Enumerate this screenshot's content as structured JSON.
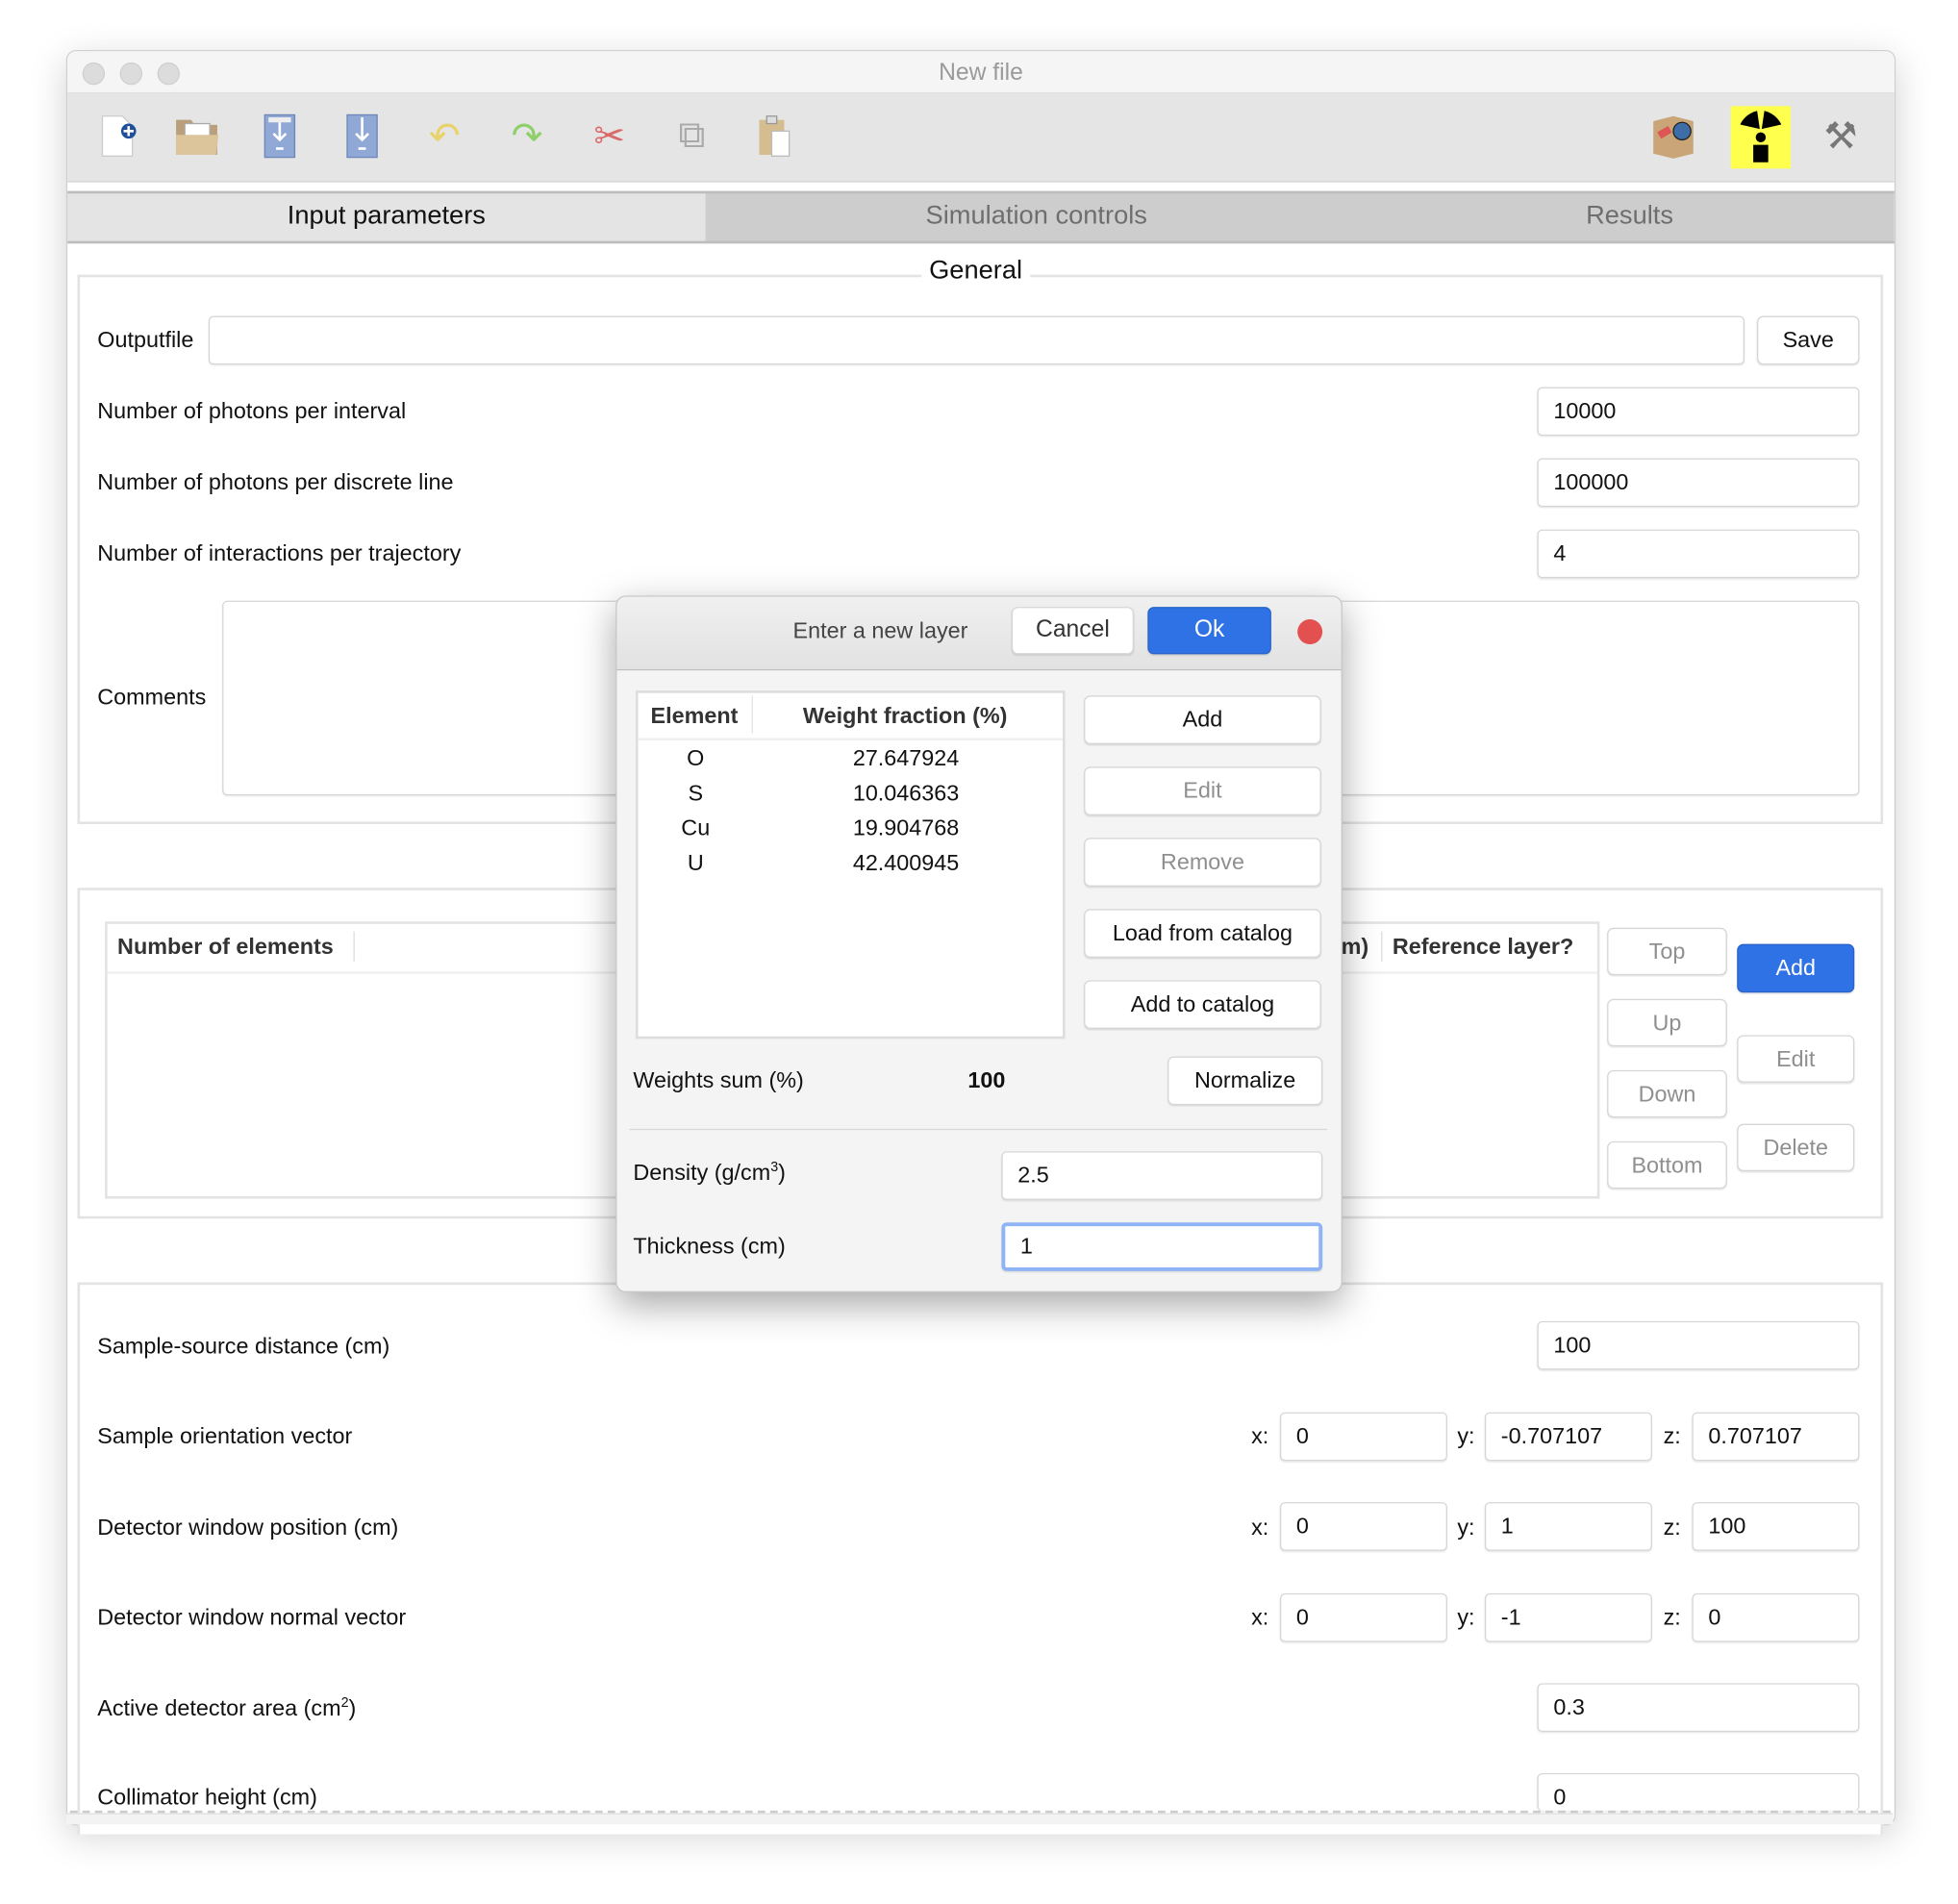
{
  "window": {
    "title": "New file"
  },
  "toolbar": {
    "icons": [
      "new-file-icon",
      "open-folder-icon",
      "save-icon",
      "save-as-icon",
      "undo-icon",
      "redo-icon",
      "cut-icon",
      "copy-icon",
      "paste-icon",
      "import-package-icon",
      "radiation-icon",
      "tools-icon"
    ]
  },
  "tabs": [
    {
      "label": "Input parameters",
      "active": true
    },
    {
      "label": "Simulation controls",
      "active": false
    },
    {
      "label": "Results",
      "active": false
    }
  ],
  "general": {
    "title": "General",
    "outputfile_label": "Outputfile",
    "outputfile_value": "",
    "save_label": "Save",
    "photons_interval_label": "Number of photons per interval",
    "photons_interval_value": "10000",
    "photons_line_label": "Number of photons per discrete line",
    "photons_line_value": "100000",
    "interactions_label": "Number of interactions per trajectory",
    "interactions_value": "4",
    "comments_label": "Comments",
    "comments_value": ""
  },
  "layers": {
    "col_elements": "Number of elements",
    "col_partial": "m)",
    "col_reference": "Reference layer?",
    "buttons": {
      "top": "Top",
      "up": "Up",
      "down": "Down",
      "bottom": "Bottom",
      "add": "Add",
      "edit": "Edit",
      "delete": "Delete"
    }
  },
  "geometry": {
    "distance_label": "Sample-source distance (cm)",
    "distance_value": "100",
    "orientation_label": "Sample orientation vector",
    "orientation": {
      "x": "0",
      "y": "-0.707107",
      "z": "0.707107"
    },
    "window_pos_label": "Detector window position (cm)",
    "window_pos": {
      "x": "0",
      "y": "1",
      "z": "100"
    },
    "window_normal_label": "Detector window normal vector",
    "window_normal": {
      "x": "0",
      "y": "-1",
      "z": "0"
    },
    "axis_x": "x:",
    "axis_y": "y:",
    "axis_z": "z:",
    "area_label": "Active detector area (cm",
    "area_sup": "2",
    "area_close": ")",
    "area_value": "0.3",
    "collimator_label": "Collimator height (cm)",
    "collimator_value": "0"
  },
  "dialog": {
    "title": "Enter a new layer",
    "cancel": "Cancel",
    "ok": "Ok",
    "table_headers": [
      "Element",
      "Weight fraction (%)"
    ],
    "rows": [
      {
        "element": "O",
        "fraction": "27.647924"
      },
      {
        "element": "S",
        "fraction": "10.046363"
      },
      {
        "element": "Cu",
        "fraction": "19.904768"
      },
      {
        "element": "U",
        "fraction": "42.400945"
      }
    ],
    "buttons": {
      "add": "Add",
      "edit": "Edit",
      "remove": "Remove",
      "load": "Load from catalog",
      "add_catalog": "Add to catalog"
    },
    "weights_sum_label": "Weights sum (%)",
    "weights_sum_value": "100",
    "normalize": "Normalize",
    "density_label": "Density (g/cm",
    "density_sup": "3",
    "density_close": ")",
    "density_value": "2.5",
    "thickness_label": "Thickness (cm)",
    "thickness_value": "1"
  },
  "colors": {
    "accent": "#2f72e6",
    "radiation_bg": "#ffff4d",
    "close_button": "#e25050"
  }
}
